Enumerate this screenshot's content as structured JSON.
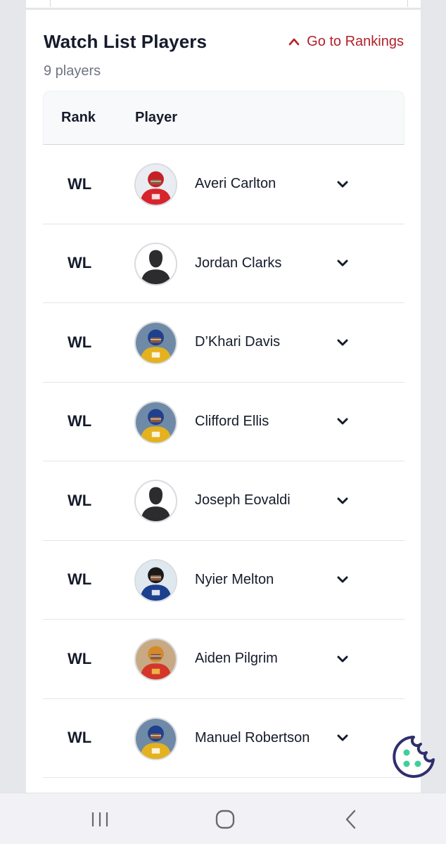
{
  "header": {
    "title": "Watch List Players",
    "count": "9 players",
    "go_link": "Go to Rankings"
  },
  "table": {
    "columns": {
      "rank": "Rank",
      "player": "Player"
    },
    "rows": [
      {
        "rank": "WL",
        "name": "Averi Carlton",
        "avatar": "red-jersey"
      },
      {
        "rank": "WL",
        "name": "Jordan Clarks",
        "avatar": "placeholder"
      },
      {
        "rank": "WL",
        "name": "D’Khari Davis",
        "avatar": "gold-jersey"
      },
      {
        "rank": "WL",
        "name": "Clifford Ellis",
        "avatar": "gold-jersey"
      },
      {
        "rank": "WL",
        "name": "Joseph Eovaldi",
        "avatar": "placeholder"
      },
      {
        "rank": "WL",
        "name": "Nyier Melton",
        "avatar": "blue-jersey"
      },
      {
        "rank": "WL",
        "name": "Aiden Pilgrim",
        "avatar": "orange-jersey"
      },
      {
        "rank": "WL",
        "name": "Manuel Robertson",
        "avatar": "gold-jersey"
      }
    ]
  },
  "icons": {
    "go_link": "chevron-up-icon",
    "row_toggle": "chevron-down-icon",
    "cookie": "cookie-icon",
    "nav": [
      "recent-apps-icon",
      "home-icon",
      "back-icon"
    ]
  },
  "colors": {
    "accent": "#b3202a",
    "text": "#151b2b",
    "muted": "#6f7480",
    "cookie": "#2f2f6e",
    "cookie_dots": "#3fcf9a"
  }
}
